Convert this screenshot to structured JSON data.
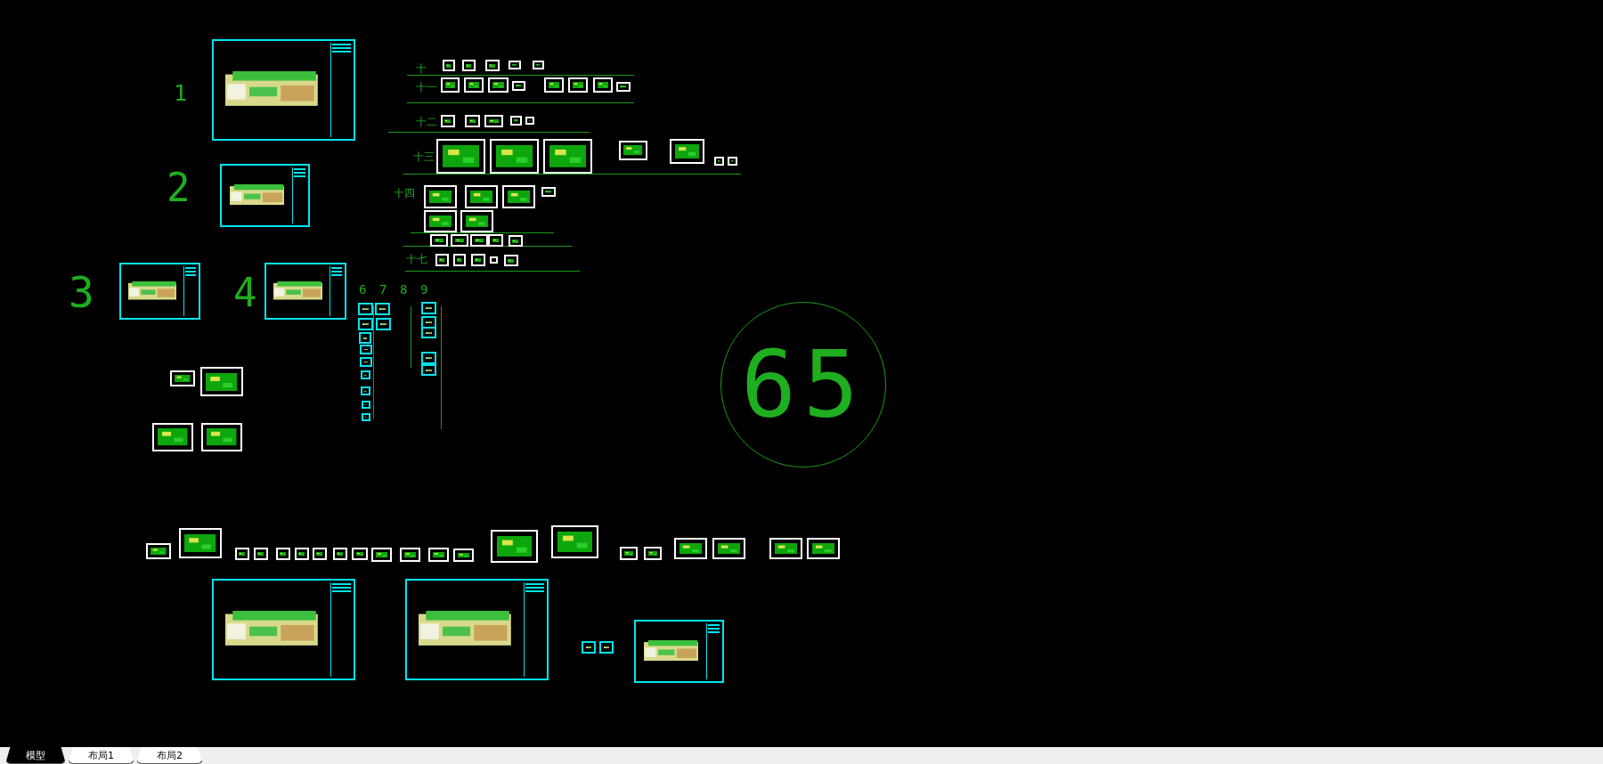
{
  "canvas": {
    "sheet_numbers": [
      "1",
      "2",
      "3",
      "4"
    ],
    "section_labels": [
      "十",
      "十一",
      "十二",
      "十三",
      "十四",
      "十七"
    ],
    "column_numbers": [
      "6",
      "7",
      "8",
      "9"
    ],
    "circled_number": "65"
  },
  "tabs": [
    {
      "label": "模型",
      "selected": true
    },
    {
      "label": "布局1",
      "selected": false
    },
    {
      "label": "布局2",
      "selected": false
    }
  ]
}
